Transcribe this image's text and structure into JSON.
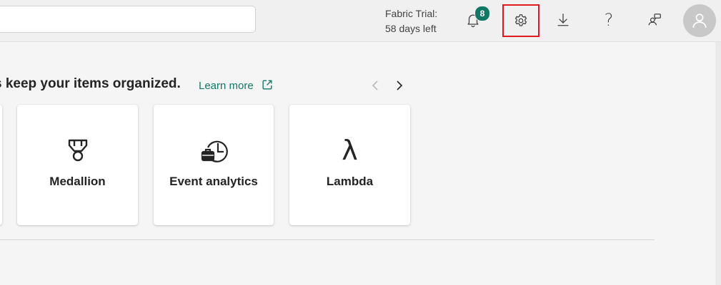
{
  "header": {
    "search": {
      "value": "",
      "placeholder": ""
    },
    "trial": {
      "line1": "Fabric Trial:",
      "line2": "58 days left"
    },
    "notifications": {
      "count": "8",
      "icon": "bell-icon"
    },
    "settings": {
      "icon": "gear-icon",
      "highlight_color": "#e0191f"
    },
    "download": {
      "icon": "download-icon"
    },
    "help": {
      "label": "?",
      "icon": "help-icon"
    },
    "share": {
      "icon": "people-share-icon"
    },
    "avatar": {
      "icon": "person-icon"
    }
  },
  "main": {
    "heading": "s keep your items organized.",
    "learn_more": "Learn more",
    "carousel": {
      "prev_icon": "chevron-left-icon",
      "next_icon": "chevron-right-icon",
      "cards": [
        {
          "label": "Medallion",
          "icon": "medal-icon"
        },
        {
          "label": "Event analytics",
          "icon": "clock-briefcase-icon"
        },
        {
          "label": "Lambda",
          "icon": "lambda-icon",
          "glyph": "λ"
        }
      ]
    }
  },
  "colors": {
    "accent": "#117865",
    "badge": "#117865",
    "highlight": "#e0191f"
  }
}
